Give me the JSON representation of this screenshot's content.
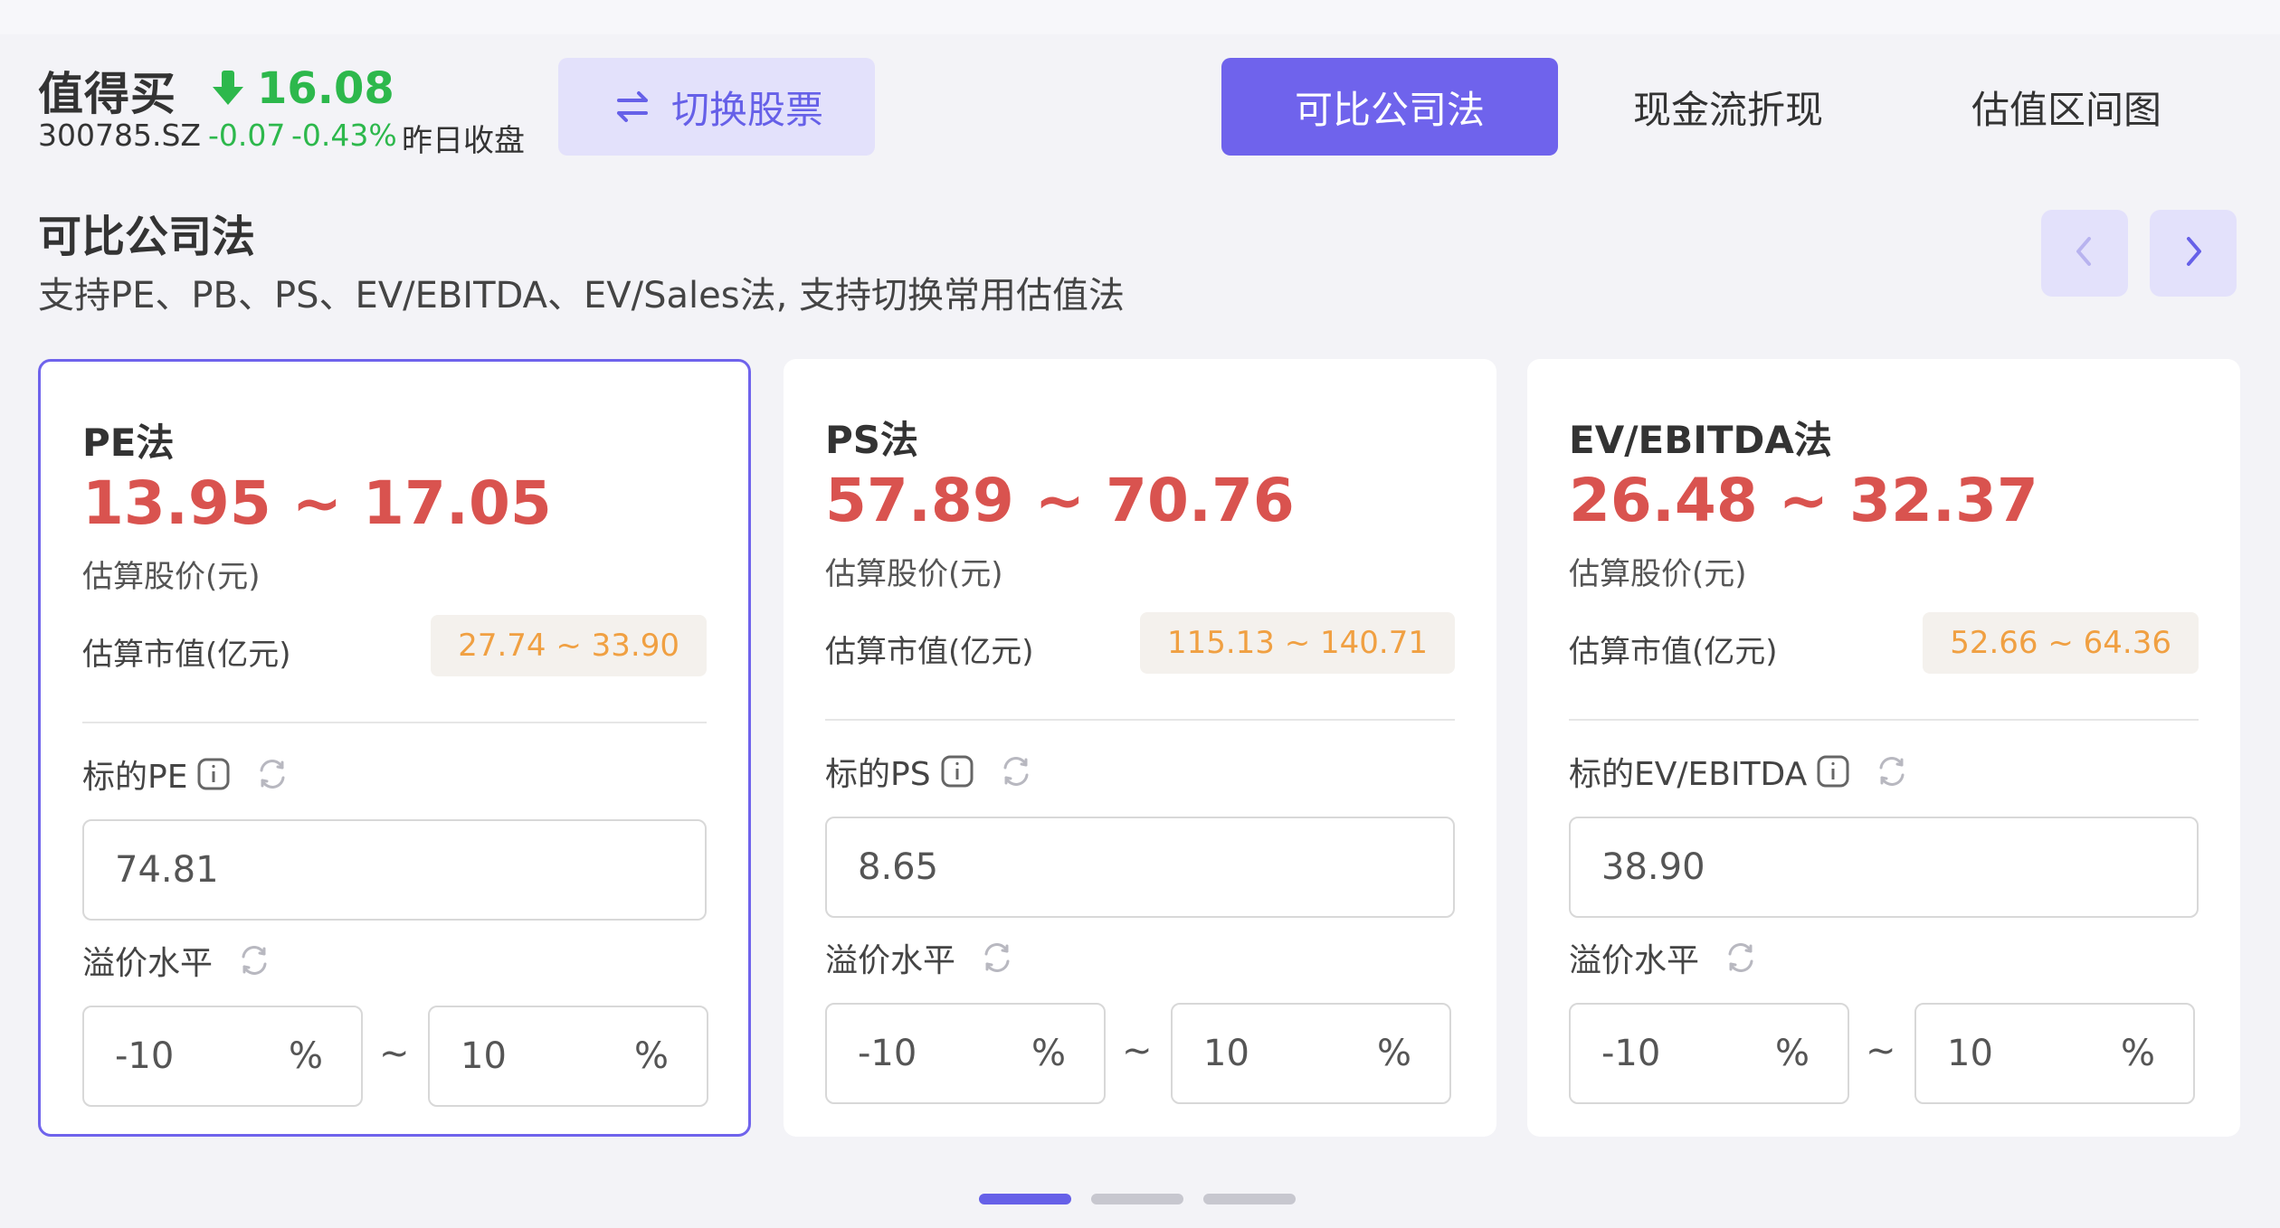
{
  "header": {
    "stock_name": "值得买",
    "price": "16.08",
    "code": "300785.SZ",
    "change": "-0.07",
    "change_pct": "-0.43%",
    "prev_close_label": "昨日收盘",
    "switch_label": "切换股票"
  },
  "tabs": [
    {
      "label": "可比公司法",
      "active": true
    },
    {
      "label": "现金流折现",
      "active": false
    },
    {
      "label": "估值区间图",
      "active": false
    }
  ],
  "section": {
    "title": "可比公司法",
    "subtitle": "支持PE、PB、PS、EV/EBITDA、EV/Sales法, 支持切换常用估值法"
  },
  "cards": [
    {
      "title": "PE法",
      "range": "13.95 ~ 17.05",
      "range_label": "估算股价(元)",
      "mv_label": "估算市值(亿元)",
      "mv_range": "27.74 ~ 33.90",
      "metric_label": "标的PE",
      "metric_value": "74.81",
      "premium_label": "溢价水平",
      "low": "-10",
      "high": "10",
      "unit": "%",
      "tilde": "~"
    },
    {
      "title": "PS法",
      "range": "57.89 ~ 70.76",
      "range_label": "估算股价(元)",
      "mv_label": "估算市值(亿元)",
      "mv_range": "115.13 ~ 140.71",
      "metric_label": "标的PS",
      "metric_value": "8.65",
      "premium_label": "溢价水平",
      "low": "-10",
      "high": "10",
      "unit": "%",
      "tilde": "~"
    },
    {
      "title": "EV/EBITDA法",
      "range": "26.48 ~ 32.37",
      "range_label": "估算股价(元)",
      "mv_label": "估算市值(亿元)",
      "mv_range": "52.66 ~ 64.36",
      "metric_label": "标的EV/EBITDA",
      "metric_value": "38.90",
      "premium_label": "溢价水平",
      "low": "-10",
      "high": "10",
      "unit": "%",
      "tilde": "~"
    }
  ],
  "colors": {
    "accent": "#6f63ec",
    "up_down_green": "#2db84c",
    "range_red": "#d9534f",
    "badge_orange": "#f0a042"
  },
  "icons": [
    "arrow-down-icon",
    "switch-arrows-icon",
    "chevron-left-icon",
    "chevron-right-icon",
    "info-icon",
    "refresh-icon"
  ]
}
